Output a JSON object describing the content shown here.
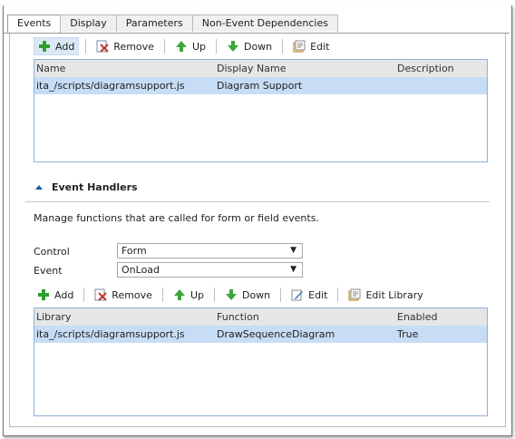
{
  "tabs": [
    {
      "label": "Events",
      "active": true
    },
    {
      "label": "Display",
      "active": false
    },
    {
      "label": "Parameters",
      "active": false
    },
    {
      "label": "Non-Event Dependencies",
      "active": false
    }
  ],
  "library_toolbar": {
    "add": "Add",
    "remove": "Remove",
    "up": "Up",
    "down": "Down",
    "edit": "Edit"
  },
  "library_grid": {
    "headers": [
      "Name",
      "Display Name",
      "Description"
    ],
    "rows": [
      {
        "name": "ita_/scripts/diagramsupport.js",
        "display_name": "Diagram Support",
        "description": ""
      }
    ]
  },
  "event_handlers": {
    "title": "Event Handlers",
    "description": "Manage functions that are called for form or field events.",
    "control_label": "Control",
    "control_value": "Form",
    "event_label": "Event",
    "event_value": "OnLoad"
  },
  "handler_toolbar": {
    "add": "Add",
    "remove": "Remove",
    "up": "Up",
    "down": "Down",
    "edit": "Edit",
    "edit_library": "Edit Library"
  },
  "handler_grid": {
    "headers": [
      "Library",
      "Function",
      "Enabled"
    ],
    "rows": [
      {
        "library": "ita_/scripts/diagramsupport.js",
        "function": "DrawSequenceDiagram",
        "enabled": "True"
      }
    ]
  },
  "colors": {
    "accent": "#1e5a9e",
    "selection": "#c7ddf5",
    "add_green": "#2e9e2e",
    "remove_red": "#c0392b"
  },
  "icons": [
    "add-icon",
    "remove-icon",
    "up-arrow-icon",
    "down-arrow-icon",
    "edit-icon",
    "edit-library-icon",
    "collapse-triangle-icon",
    "dropdown-arrow-icon"
  ]
}
